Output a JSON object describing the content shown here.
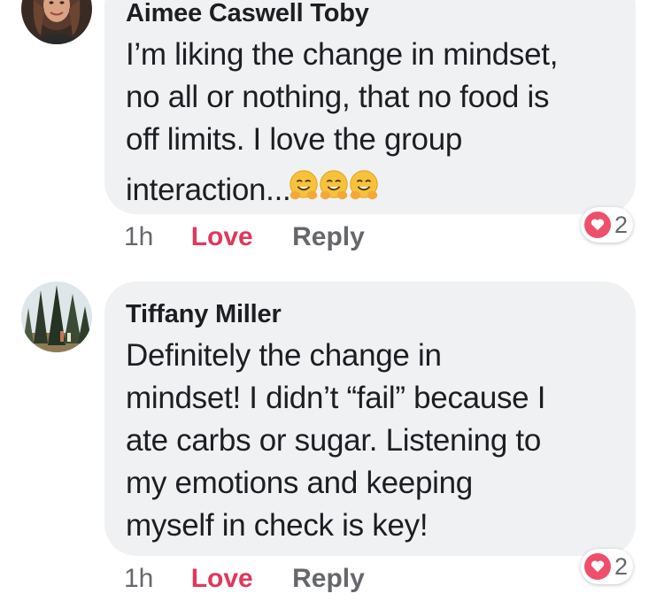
{
  "comments": [
    {
      "author": "Aimee Caswell Toby",
      "avatar_icon": "avatar-photo-woman",
      "text_lines": [
        "I’m liking the change in mindset,",
        "no all or nothing, that no food is",
        "off limits.  I love the group",
        "interaction..."
      ],
      "emojis": [
        "hugging-face-emoji",
        "hugging-face-emoji",
        "hugging-face-emoji"
      ],
      "time": "1h",
      "love_label": "Love",
      "reply_label": "Reply",
      "reaction_icon": "heart-icon",
      "reaction_count": "2"
    },
    {
      "author": "Tiffany Miller",
      "avatar_icon": "avatar-photo-forest",
      "text_lines": [
        "Definitely the change in",
        "mindset! I didn’t “fail” because I",
        "ate carbs or sugar. Listening to",
        "my emotions and keeping",
        "myself in check is key!"
      ],
      "time": "1h",
      "love_label": "Love",
      "reply_label": "Reply",
      "reaction_icon": "heart-icon",
      "reaction_count": "2"
    }
  ],
  "colors": {
    "bubble": "#f0f1f3",
    "love_active": "#e0385b",
    "secondary_text": "#65676b",
    "heart_badge": "#ef4f6b"
  }
}
